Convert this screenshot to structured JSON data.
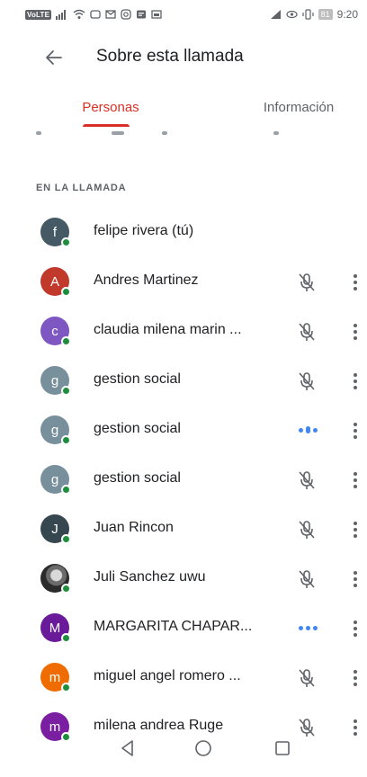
{
  "status_bar": {
    "volte": "VoLTE",
    "battery": "81",
    "time": "9:20"
  },
  "header": {
    "title": "Sobre esta llamada",
    "back_icon": "arrow-back-icon"
  },
  "tabs": [
    {
      "label": "Personas",
      "active": true
    },
    {
      "label": "Información",
      "active": false
    }
  ],
  "section": {
    "label": "EN LA LLAMADA"
  },
  "colors": {
    "accent": "#d93025",
    "online": "#1e8e3e",
    "speaking": "#4285f4"
  },
  "participants": [
    {
      "initial": "f",
      "name": "felipe rivera (tú)",
      "avatar_color": "#455a64",
      "mic": "none"
    },
    {
      "initial": "A",
      "name": "Andres Martinez",
      "avatar_color": "#c0392b",
      "mic": "muted"
    },
    {
      "initial": "c",
      "name": "claudia milena marin ...",
      "avatar_color": "#7e57c2",
      "mic": "muted"
    },
    {
      "initial": "g",
      "name": "gestion social",
      "avatar_color": "#78909c",
      "mic": "muted"
    },
    {
      "initial": "g",
      "name": "gestion social",
      "avatar_color": "#78909c",
      "mic": "speaking"
    },
    {
      "initial": "g",
      "name": "gestion social",
      "avatar_color": "#78909c",
      "mic": "muted"
    },
    {
      "initial": "J",
      "name": "Juan Rincon",
      "avatar_color": "#37474f",
      "mic": "muted"
    },
    {
      "initial": "",
      "name": "Juli Sanchez uwu",
      "avatar_color": "#2b2b2b",
      "mic": "muted",
      "photo": true
    },
    {
      "initial": "M",
      "name": "MARGARITA CHAPAR...",
      "avatar_color": "#6a1b9a",
      "mic": "speaking-idle"
    },
    {
      "initial": "m",
      "name": "miguel angel romero ...",
      "avatar_color": "#ef6c00",
      "mic": "muted"
    },
    {
      "initial": "m",
      "name": "milena andrea Ruge",
      "avatar_color": "#7b1fa2",
      "mic": "muted"
    }
  ],
  "nav_bar": {
    "back_icon": "nav-back-icon",
    "home_icon": "nav-home-icon",
    "recents_icon": "nav-recents-icon"
  }
}
